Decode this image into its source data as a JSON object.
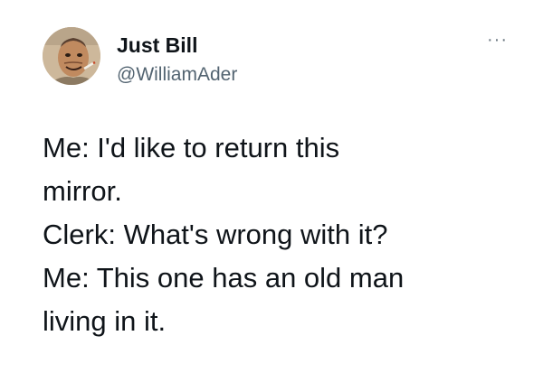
{
  "author": {
    "name": "Just Bill",
    "handle": "@WilliamAder",
    "avatar_icon": "profile-photo"
  },
  "more_icon": "ellipsis-icon",
  "more_label": "···",
  "tweet_lines": [
    "Me: I'd like to return this",
    "mirror.",
    "Clerk: What's wrong with it?",
    "Me: This one has an old man",
    "living in it."
  ],
  "colors": {
    "text": "#0f1419",
    "handle": "#536471"
  }
}
